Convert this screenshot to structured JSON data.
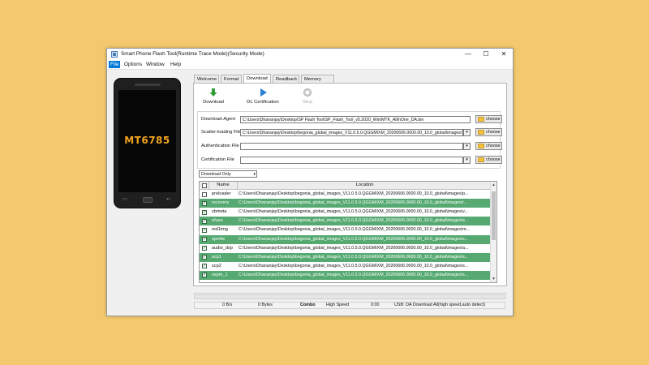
{
  "window": {
    "title": "Smart Phone Flash Tool(Runtime Trace Mode)(Security Mode)",
    "controls": {
      "minimize": "—",
      "maximize": "☐",
      "close": "✕"
    }
  },
  "menu": [
    "File",
    "Options",
    "Window",
    "Help"
  ],
  "phone": {
    "chip": "MT6785"
  },
  "tabs": [
    "Welcome",
    "Format",
    "Download",
    "Readback",
    "Memory Test"
  ],
  "toolbar": {
    "download": "Download",
    "dl_certification": "DL Certification",
    "stop": "Stop"
  },
  "form": {
    "download_agent_label": "Download-Agent",
    "download_agent_value": "C:\\Users\\Dhananjay\\Desktop\\SP Flash Tool\\SP_Flash_Tool_v5.2020_Win\\MTK_AllInOne_DA.bin",
    "scatter_label": "Scatter-loading File",
    "scatter_value": "C:\\Users\\Dhananjay\\Desktop\\begonia_global_images_V11.0.5.0.QGGMIXM_20200606.0000.00_10.0_global\\images\\",
    "auth_label": "Authentication File",
    "auth_value": "",
    "cert_label": "Certification File",
    "cert_value": "",
    "choose": "choose"
  },
  "mode": "Download Only",
  "table": {
    "headers": [
      "Name",
      "Location"
    ],
    "rows": [
      {
        "name": "preloader",
        "checked": false,
        "selected": false,
        "location": "C:\\Users\\Dhananjay\\Desktop\\begonia_global_images_V11.0.5.0.QGGMIXM_20200606.0000.00_10.0_global\\images\\p..."
      },
      {
        "name": "recovery",
        "checked": true,
        "selected": true,
        "location": "C:\\Users\\Dhananjay\\Desktop\\begonia_global_images_V11.0.5.0.QGGMIXM_20200606.0000.00_10.0_global\\images\\r..."
      },
      {
        "name": "vbmeta",
        "checked": true,
        "selected": false,
        "location": "C:\\Users\\Dhananjay\\Desktop\\begonia_global_images_V11.0.5.0.QGGMIXM_20200606.0000.00_10.0_global\\images\\v..."
      },
      {
        "name": "efuse",
        "checked": true,
        "selected": true,
        "location": "C:\\Users\\Dhananjay\\Desktop\\begonia_global_images_V11.0.5.0.QGGMIXM_20200606.0000.00_10.0_global\\images\\e..."
      },
      {
        "name": "md1img",
        "checked": true,
        "selected": false,
        "location": "C:\\Users\\Dhananjay\\Desktop\\begonia_global_images_V11.0.5.0.QGGMIXM_20200606.0000.00_10.0_global\\images\\m..."
      },
      {
        "name": "spmfw",
        "checked": true,
        "selected": true,
        "location": "C:\\Users\\Dhananjay\\Desktop\\begonia_global_images_V11.0.5.0.QGGMIXM_20200606.0000.00_10.0_global\\images\\s..."
      },
      {
        "name": "audio_dsp",
        "checked": true,
        "selected": false,
        "location": "C:\\Users\\Dhananjay\\Desktop\\begonia_global_images_V11.0.5.0.QGGMIXM_20200606.0000.00_10.0_global\\images\\a..."
      },
      {
        "name": "scp1",
        "checked": true,
        "selected": true,
        "location": "C:\\Users\\Dhananjay\\Desktop\\begonia_global_images_V11.0.5.0.QGGMIXM_20200606.0000.00_10.0_global\\images\\s..."
      },
      {
        "name": "scp2",
        "checked": true,
        "selected": false,
        "location": "C:\\Users\\Dhananjay\\Desktop\\begonia_global_images_V11.0.5.0.QGGMIXM_20200606.0000.00_10.0_global\\images\\s..."
      },
      {
        "name": "sspm_1",
        "checked": true,
        "selected": true,
        "location": "C:\\Users\\Dhananjay\\Desktop\\begonia_global_images_V11.0.5.0.QGGMIXM_20200606.0000.00_10.0_global\\images\\s..."
      }
    ]
  },
  "status": {
    "speed": "0 B/s",
    "bytes": "0 Bytes",
    "connection": "Combo",
    "speed_mode": "High Speed",
    "time": "0:00",
    "message": "USB: DA Download All(high speed,auto detect)",
    "progress": 0
  },
  "colors": {
    "background": "#f4c96e",
    "selected_row": "#55a971",
    "menu_active": "#0078d7",
    "chip_label": "#f2a41d"
  },
  "icons": {
    "download": "green-down-arrow-icon",
    "dl_certification": "blue-play-icon",
    "stop": "stop-icon",
    "choose": "folder-icon"
  }
}
